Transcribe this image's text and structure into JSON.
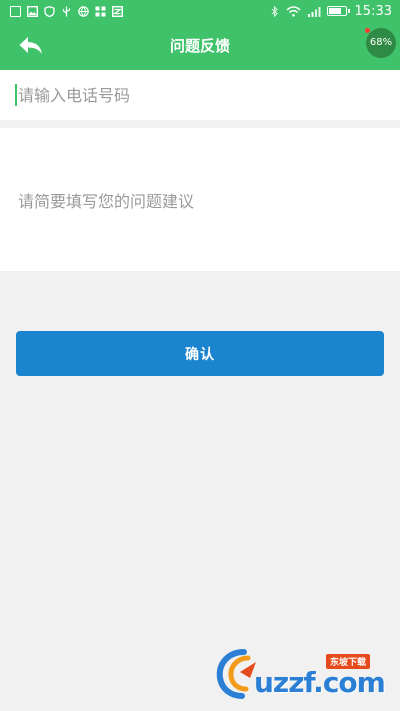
{
  "status_bar": {
    "time": "15:33",
    "battery_level": 0.8,
    "left_icons": [
      "notification-icon",
      "image-icon",
      "shield-icon",
      "usb-icon",
      "globe-icon",
      "grid-icon",
      "mail-icon"
    ],
    "right_icons": [
      "bluetooth-icon",
      "wifi-icon",
      "signal-icon",
      "battery-icon"
    ]
  },
  "app_bar": {
    "title": "问题反馈",
    "percent_badge": "68%",
    "color": "#3fc26a"
  },
  "form": {
    "phone_placeholder": "请输入电话号码",
    "feedback_placeholder": "请简要填写您的问题建议",
    "confirm_label": "确认",
    "confirm_color": "#1b84cf"
  },
  "watermark": {
    "logo_text": "uzzf.com",
    "tag_text": "东坡下载"
  }
}
